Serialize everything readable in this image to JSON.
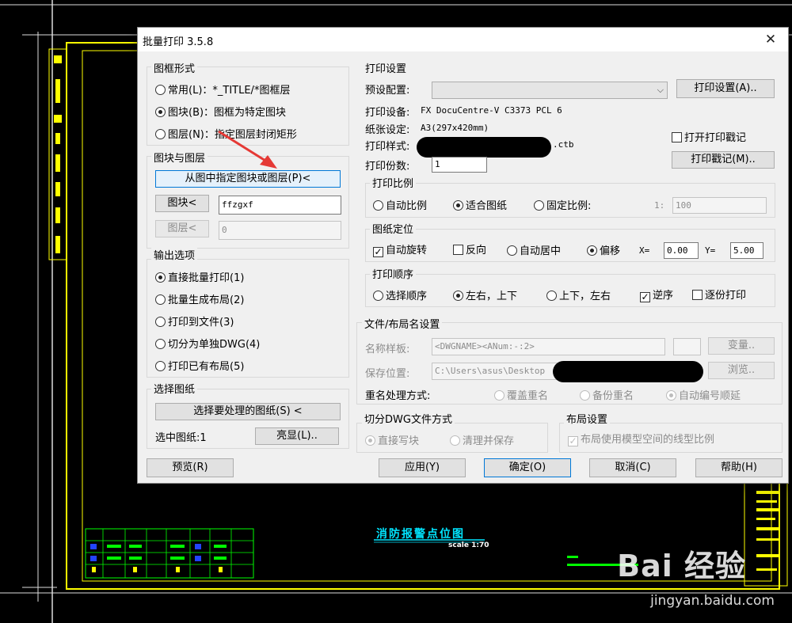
{
  "dialog": {
    "title": "批量打印 3.5.8",
    "close_icon": "close-icon"
  },
  "frame_form": {
    "label": "图框形式",
    "options": [
      {
        "label": "常用(L)：*_TITLE/*图框层",
        "selected": false
      },
      {
        "label": "图块(B)：图框为特定图块",
        "selected": true
      },
      {
        "label": "图层(N)：指定图层封闭矩形",
        "selected": false
      }
    ]
  },
  "block_layer": {
    "label": "图块与图层",
    "pick_button": "从图中指定图块或图层(P)<",
    "block_button": "图块<",
    "block_value": "ffzgxf",
    "layer_button": "图层<",
    "layer_value": "0"
  },
  "output": {
    "label": "输出选项",
    "options": [
      {
        "label": "直接批量打印(1)",
        "selected": true
      },
      {
        "label": "批量生成布局(2)",
        "selected": false
      },
      {
        "label": "打印到文件(3)",
        "selected": false
      },
      {
        "label": "切分为单独DWG(4)",
        "selected": false
      },
      {
        "label": "打印已有布局(5)",
        "selected": false
      }
    ]
  },
  "select_drawing": {
    "label": "选择图纸",
    "select_button": "选择要处理的图纸(S) <",
    "selected_text": "选中图纸:1",
    "highlight_button": "亮显(L).."
  },
  "print_settings": {
    "label": "打印设置",
    "preset_label": "预设配置:",
    "preset_value": "",
    "settings_button": "打印设置(A)..",
    "device_label": "打印设备:",
    "device_value": "FX DocuCentre-V C3373 PCL 6",
    "paper_label": "纸张设定:",
    "paper_value": "A3(297x420mm)",
    "style_label": "打印样式:",
    "style_suffix": ".ctb",
    "stamp_check": "打开打印戳记",
    "stamp_checked": false,
    "stamp_button": "打印戳记(M)..",
    "copies_label": "打印份数:",
    "copies_value": "1"
  },
  "scale": {
    "label": "打印比例",
    "options": [
      {
        "label": "自动比例",
        "selected": false
      },
      {
        "label": "适合图纸",
        "selected": true
      },
      {
        "label": "固定比例:",
        "selected": false
      }
    ],
    "ratio_prefix": "1:",
    "ratio_value": "100"
  },
  "position": {
    "label": "图纸定位",
    "auto_rotate": "自动旋转",
    "auto_rotate_checked": true,
    "reverse": "反向",
    "reverse_checked": false,
    "center": "自动居中",
    "offset": "偏移",
    "x_label": "X=",
    "x_value": "0.00",
    "y_label": "Y=",
    "y_value": "5.00"
  },
  "order": {
    "label": "打印顺序",
    "options": [
      {
        "label": "选择顺序",
        "selected": false
      },
      {
        "label": "左右，上下",
        "selected": true
      },
      {
        "label": "上下，左右",
        "selected": false
      }
    ],
    "reverse": "逆序",
    "reverse_checked": true,
    "collate": "逐份打印",
    "collate_checked": false
  },
  "file_layout": {
    "label": "文件/布局名设置",
    "name_label": "名称样板:",
    "name_value": "<DWGNAME><ANum:-:2>",
    "var_button": "变量..",
    "path_label": "保存位置:",
    "path_value": "C:\\Users\\asus\\Desktop",
    "browse_button": "浏览..",
    "rename_label": "重名处理方式:",
    "rename_options": [
      {
        "label": "覆盖重名",
        "selected": false
      },
      {
        "label": "备份重名",
        "selected": false
      },
      {
        "label": "自动编号顺延",
        "selected": true
      }
    ]
  },
  "split": {
    "label": "切分DWG文件方式",
    "options": [
      {
        "label": "直接写块",
        "selected": true
      },
      {
        "label": "清理并保存",
        "selected": false
      }
    ]
  },
  "layout_settings": {
    "label": "布局设置",
    "check": "布局使用模型空间的线型比例",
    "checked": true
  },
  "footer": {
    "preview": "预览(R)",
    "apply": "应用(Y)",
    "ok": "确定(O)",
    "cancel": "取消(C)",
    "help": "帮助(H)"
  },
  "cad": {
    "title": "消防报警点位图",
    "scale": "scale 1:70"
  },
  "watermark": {
    "logo": "Bai 经验",
    "url": "jingyan.baidu.com"
  },
  "colors": {
    "cad_yellow": "#ffff00",
    "cad_green": "#00ff00",
    "cad_cyan": "#00e5ff",
    "dialog_bg": "#f0f0f0",
    "focus_blue": "#0078d7",
    "annotation_red": "#e53935"
  }
}
